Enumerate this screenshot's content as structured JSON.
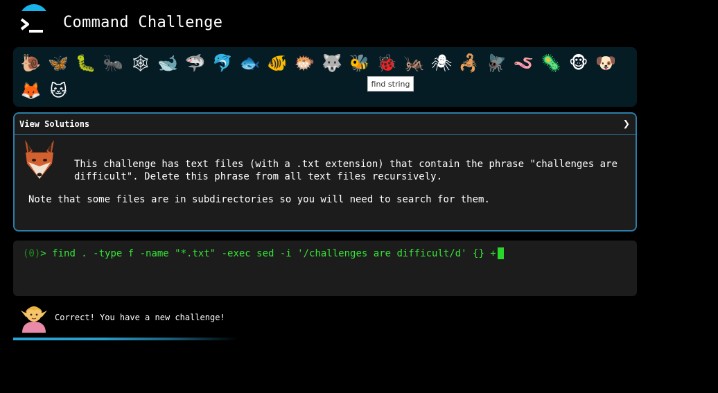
{
  "header": {
    "title": "Command Challenge",
    "logo_icon": "terminal-prompt-icon"
  },
  "levels": [
    {
      "name": "snail-icon",
      "glyph": "🐌"
    },
    {
      "name": "butterfly-icon",
      "glyph": "🦋"
    },
    {
      "name": "caterpillar-icon",
      "glyph": "🐛"
    },
    {
      "name": "ant-icon",
      "glyph": "🐜"
    },
    {
      "name": "spider-web-icon",
      "glyph": "🕸"
    },
    {
      "name": "whale-icon",
      "glyph": "🐋"
    },
    {
      "name": "shark-icon",
      "glyph": "🦈"
    },
    {
      "name": "dolphin-icon",
      "glyph": "🐬"
    },
    {
      "name": "fish-icon",
      "glyph": "🐟"
    },
    {
      "name": "tropical-fish-icon",
      "glyph": "🐠"
    },
    {
      "name": "blowfish-icon",
      "glyph": "🐡"
    },
    {
      "name": "wolf-icon",
      "glyph": "🐺"
    },
    {
      "name": "bee-icon",
      "glyph": "🐝"
    },
    {
      "name": "ladybug-icon",
      "glyph": "🐞"
    },
    {
      "name": "cricket-icon",
      "glyph": "🦗"
    },
    {
      "name": "spider-icon",
      "glyph": "🕷"
    },
    {
      "name": "scorpion-icon",
      "glyph": "🦂"
    },
    {
      "name": "fly-icon",
      "glyph": "🪰"
    },
    {
      "name": "worm-icon",
      "glyph": "🪱"
    },
    {
      "name": "microbe-icon",
      "glyph": "🦠"
    },
    {
      "name": "monkey-face-icon",
      "glyph": "🐵"
    },
    {
      "name": "dog-face-icon",
      "glyph": "🐶"
    },
    {
      "name": "fox-face-icon",
      "glyph": "🦊"
    },
    {
      "name": "cat-face-icon",
      "glyph": "🐱"
    }
  ],
  "tooltip": "find string",
  "challenge": {
    "header_label": "View Solutions",
    "expand_icon": "chevron-right-icon",
    "avatar_icon": "fox-face-icon",
    "description": "This challenge has text files (with a .txt extension) that contain the phrase \"challenges are difficult\". Delete this phrase from all text files recursively.",
    "note": "Note that some files are in subdirectories so you will need to search for them."
  },
  "terminal": {
    "exit_status": "(0)",
    "prompt": "> ",
    "command": "find . -type f -name \"*.txt\" -exec sed -i '/challenges are difficult/d' {} +"
  },
  "result": {
    "avatar_icon": "elf-avatar-icon",
    "message": "Correct! You have a new challenge!"
  },
  "progress": {
    "value": 0.6
  },
  "colors": {
    "accent": "#17b3e9",
    "panel_border": "#2a7ea7",
    "terminal_text": "#35e535",
    "icon_bar_bg": "#061c25"
  }
}
